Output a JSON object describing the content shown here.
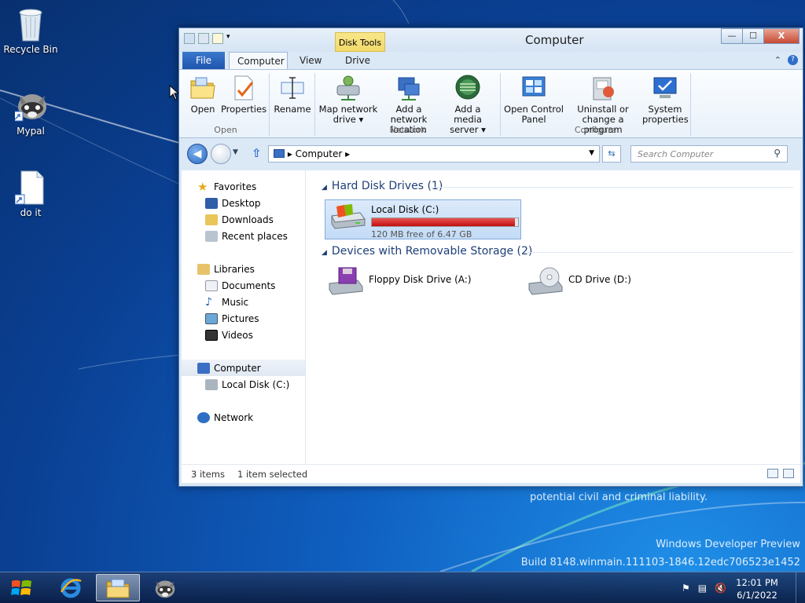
{
  "desktop": {
    "icons": [
      {
        "label": "Recycle Bin"
      },
      {
        "label": "Mypal"
      },
      {
        "label": "do it"
      }
    ],
    "watermark": {
      "line1": "potential civil and criminal liability.",
      "line2": "Windows Developer Preview",
      "line3": "Build 8148.winmain.111103-1846.12edc706523e1452"
    }
  },
  "window": {
    "title": "Computer",
    "context_tab": "Disk Tools",
    "buttons": {
      "minimize": "—",
      "maximize": "☐",
      "close": "X"
    },
    "tabs": {
      "file": "File",
      "computer": "Computer",
      "view": "View",
      "drive": "Drive"
    },
    "ribbon": {
      "groups": {
        "open": "Open",
        "network": "Network",
        "configure": "Configure"
      },
      "open": "Open",
      "properties": "Properties",
      "rename": "Rename",
      "map_network_drive_l1": "Map network",
      "map_network_drive_l2": "drive ▾",
      "add_network_location_l1": "Add a network",
      "add_network_location_l2": "location",
      "add_media_server_l1": "Add a media",
      "add_media_server_l2": "server ▾",
      "open_control_panel_l1": "Open Control",
      "open_control_panel_l2": "Panel",
      "uninstall_l1": "Uninstall or",
      "uninstall_l2": "change a program",
      "system_properties_l1": "System",
      "system_properties_l2": "properties"
    },
    "address": {
      "path": "▸  Computer  ▸",
      "search_placeholder": "Search Computer"
    },
    "nav": {
      "favorites": "Favorites",
      "desktop": "Desktop",
      "downloads": "Downloads",
      "recent": "Recent places",
      "libraries": "Libraries",
      "documents": "Documents",
      "music": "Music",
      "pictures": "Pictures",
      "videos": "Videos",
      "computer": "Computer",
      "local_disk": "Local Disk (C:)",
      "network": "Network"
    },
    "content": {
      "hdd_header": "Hard Disk Drives (1)",
      "removable_header": "Devices with Removable Storage (2)",
      "local_disk": {
        "name": "Local Disk (C:)",
        "free": "120 MB free of 6.47 GB",
        "used_fraction": 0.98
      },
      "floppy": {
        "name": "Floppy Disk Drive (A:)"
      },
      "cd": {
        "name": "CD Drive (D:)"
      }
    },
    "status": {
      "items": "3 items",
      "selected": "1 item selected"
    }
  },
  "taskbar": {
    "time": "12:01 PM",
    "date": "6/1/2022"
  },
  "colors": {
    "accent": "#1e56ad",
    "usage_bar": "#c20e0e",
    "section_header": "#1e3f78"
  }
}
